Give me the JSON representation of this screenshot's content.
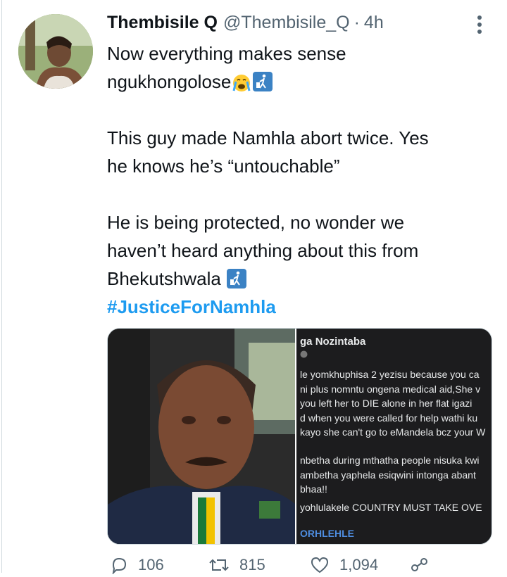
{
  "tweet": {
    "display_name": "Thembisile Q",
    "handle": "@Thembisile_Q",
    "separator": "·",
    "time": "4h",
    "lines": [
      "Now everything makes sense",
      "ngukhongolose",
      "This guy made Namhla abort twice.  Yes",
      "he knows he’s “untouchable”",
      "He is being protected, no wonder we",
      "haven’t heard anything about this from",
      "Bhekutshwala"
    ],
    "hashtag": "#JusticeForNamhla"
  },
  "media": {
    "screenshot": {
      "title": "ga Nozintaba",
      "lines_a": [
        "le yomkhuphisa 2 yezisu because you ca",
        "ni plus nomntu ongena medical aid,She v",
        " you left her to DIE alone in her flat igazi",
        "d when you were called for help wathi ku",
        "kayo she can't go to eMandela bcz your W"
      ],
      "lines_b": [
        "nbetha during mthatha people nisuka kwi",
        "ambetha yaphela esiqwini intonga abant",
        "bhaa!!"
      ],
      "line_c": " yohlulakele COUNTRY MUST TAKE OVE",
      "link_text": "ORHLEHLE"
    }
  },
  "actions": {
    "replies": "106",
    "retweets": "815",
    "likes": "1,094"
  },
  "icons": {
    "more": "more-vertical-icon",
    "reply": "reply-icon",
    "retweet": "retweet-icon",
    "like": "heart-icon",
    "share": "share-icon",
    "emoji1": "crying-face-emoji",
    "emoji2": "litter-bin-emoji"
  },
  "colors": {
    "accent": "#1d9bf0",
    "muted": "#536471",
    "text": "#0f1419"
  }
}
